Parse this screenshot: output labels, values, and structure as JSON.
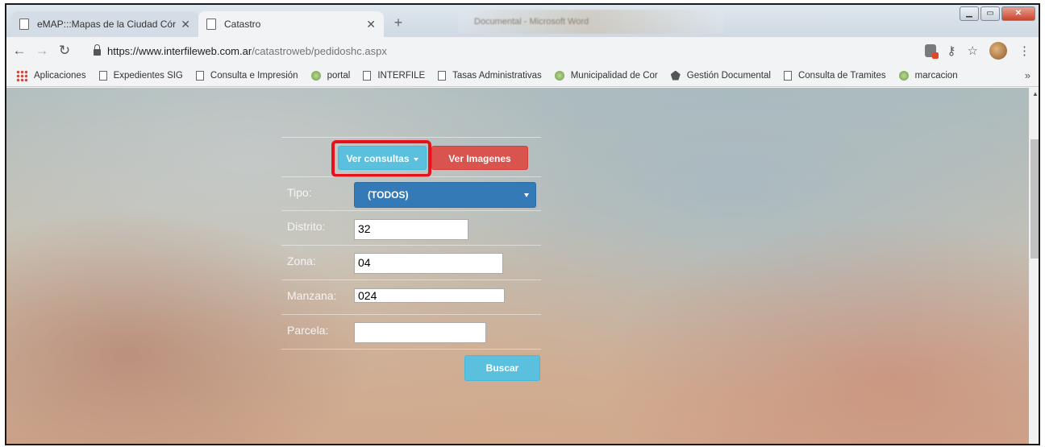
{
  "browser": {
    "tabs": [
      {
        "title": "eMAP:::Mapas de la Ciudad Córd"
      },
      {
        "title": "Catastro"
      }
    ],
    "background_window_title": "Documental - Microsoft Word",
    "url_host": "https://www.interfileweb.com.ar",
    "url_path": "/catastroweb/pedidoshc.aspx",
    "bookmarks": [
      {
        "label": "Aplicaciones",
        "icon": "apps-grid-icon"
      },
      {
        "label": "Expedientes SIG",
        "icon": "page-icon"
      },
      {
        "label": "Consulta e Impresión",
        "icon": "page-icon"
      },
      {
        "label": "portal",
        "icon": "seal-icon"
      },
      {
        "label": "INTERFILE",
        "icon": "page-icon"
      },
      {
        "label": "Tasas Administrativas",
        "icon": "page-icon"
      },
      {
        "label": "Municipalidad de Cor",
        "icon": "seal-icon"
      },
      {
        "label": "Gestión Documental",
        "icon": "drive-icon"
      },
      {
        "label": "Consulta de Tramites",
        "icon": "page-icon"
      },
      {
        "label": "marcacion",
        "icon": "seal-icon"
      }
    ],
    "more_label": "»"
  },
  "form": {
    "ver_consultas_label": "Ver consultas",
    "ver_imagenes_label": "Ver Imagenes",
    "tipo_label": "Tipo:",
    "tipo_value": "(TODOS)",
    "distrito_label": "Distrito:",
    "distrito_value": "32",
    "zona_label": "Zona:",
    "zona_value": "04",
    "manzana_label": "Manzana:",
    "manzana_value": "024",
    "parcela_label": "Parcela:",
    "parcela_value": "",
    "buscar_label": "Buscar"
  },
  "colors": {
    "info": "#5bc0de",
    "danger": "#d9534f",
    "primary": "#337ab7",
    "highlight": "#e8111b"
  }
}
